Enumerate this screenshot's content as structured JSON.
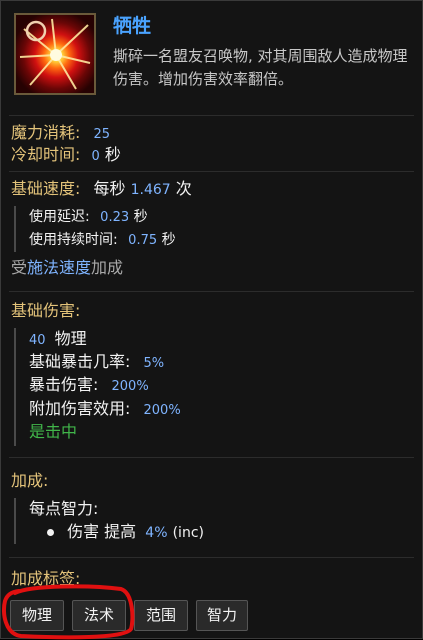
{
  "skill": {
    "name": "牺牲",
    "description": "撕碎一名盟友召唤物, 对其周围敌人造成物理伤害。增加伤害效率翻倍。",
    "icon": "sacrifice-explosion-icon"
  },
  "cost": {
    "mana_label": "魔力消耗:",
    "mana_value": "25",
    "cooldown_label": "冷却时间:",
    "cooldown_value": "0",
    "cooldown_unit": "秒"
  },
  "speed": {
    "label": "基础速度:",
    "prefix": "每秒",
    "value": "1.467",
    "unit": "次",
    "delay_label": "使用延迟:",
    "delay_value": "0.23",
    "delay_unit": "秒",
    "duration_label": "使用持续时间:",
    "duration_value": "0.75",
    "duration_unit": "秒",
    "affected_prefix": "受",
    "affected_link": "施法速度",
    "affected_suffix": "加成"
  },
  "damage": {
    "label": "基础伤害:",
    "amount": "40",
    "type": "物理",
    "crit_label": "基础暴击几率:",
    "crit_value": "5%",
    "critdmg_label": "暴击伤害:",
    "critdmg_value": "200%",
    "extra_label": "附加伤害效用:",
    "extra_value": "200%",
    "hit_text": "是击中"
  },
  "scaling": {
    "label": "加成:",
    "per_label": "每点智力:",
    "bullet_text": "伤害 提高",
    "bullet_value": "4%",
    "bullet_suffix": "(inc)"
  },
  "tags": {
    "label": "加成标签:",
    "items": [
      "物理",
      "法术",
      "范围",
      "智力"
    ]
  },
  "colors": {
    "title": "#4aa3ff",
    "label_gold": "#e3c37a",
    "value_blue": "#7fb4ff",
    "hit_green": "#41b64a",
    "annotation_red": "#e01010"
  }
}
